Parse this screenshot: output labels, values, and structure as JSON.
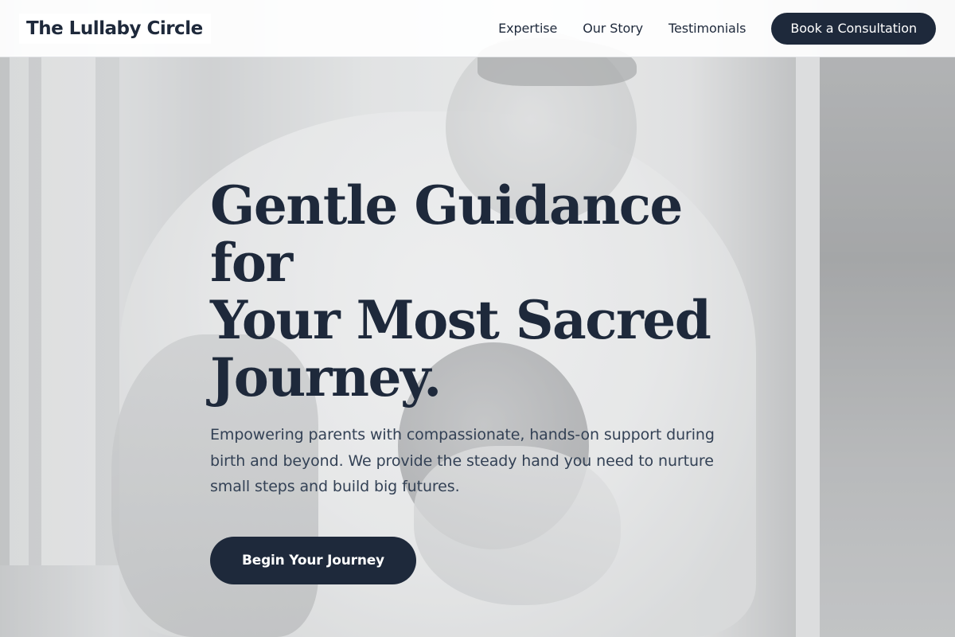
{
  "nav": {
    "logo": "The Lullaby Circle",
    "links": [
      "Expertise",
      "Our Story",
      "Testimonials"
    ],
    "cta_label": "Book a Consultation"
  },
  "hero": {
    "title_lines": [
      "Gentle Guidance for",
      "Your Most Sacred",
      "Journey."
    ],
    "subtitle": "Empowering parents with compassionate, hands-on support during birth and beyond. We provide the steady hand you need to nurture small steps and build big futures.",
    "cta_label": "Begin Your Journey"
  },
  "colors": {
    "primary": "#1e293b",
    "body_text": "#334155",
    "nav_background": "#ffffff"
  }
}
